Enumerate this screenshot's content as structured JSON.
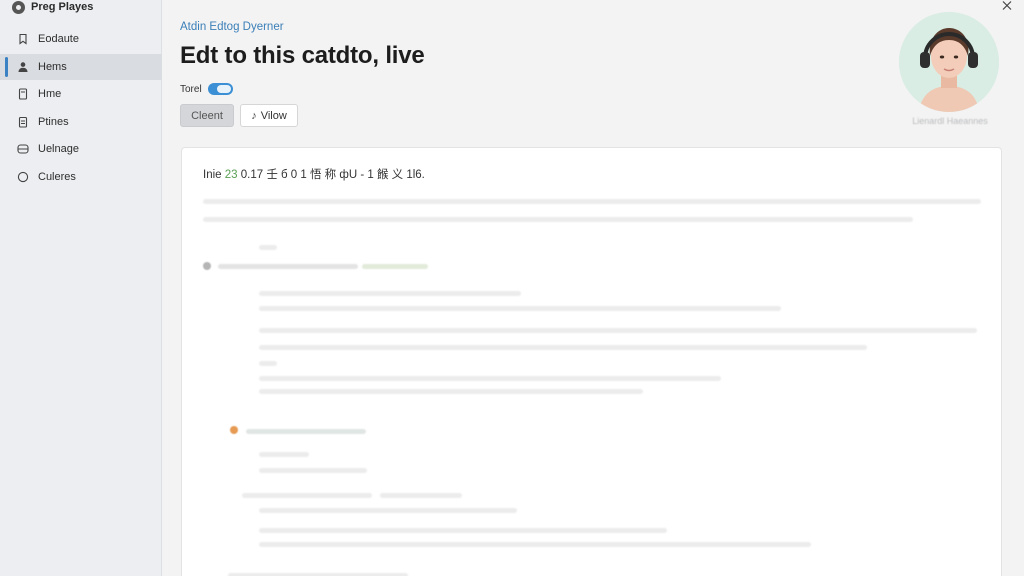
{
  "app": {
    "title": "Preg Playes"
  },
  "sidebar": {
    "items": [
      {
        "label": "Eodaute",
        "icon": "bookmark-icon"
      },
      {
        "label": "Hems",
        "icon": "person-icon"
      },
      {
        "label": "Hme",
        "icon": "document-icon"
      },
      {
        "label": "Ptines",
        "icon": "clipboard-icon"
      },
      {
        "label": "Uelnage",
        "icon": "stack-icon"
      },
      {
        "label": "Culeres",
        "icon": "circle-icon"
      }
    ],
    "active_index": 1
  },
  "header": {
    "subtitle": "Atdin Edtog Dyerner",
    "title": "Edt to this catdto, live",
    "toggle_label": "Torel",
    "toggle_on": true,
    "primary_button": "Cleent",
    "view_button": "Vilow"
  },
  "profile": {
    "caption": "Lienardl Haeannes"
  },
  "card": {
    "line_prefix": "Inie ",
    "line_num": "23",
    "line_rest": " 0.17 壬 б 0 1 悟 称 фU - 1 餱 义 1l6."
  },
  "colors": {
    "accent": "#3b82c4",
    "link": "#3b7fb8",
    "sidebar_bg": "#eceef1",
    "page_bg": "#f3f3f3"
  }
}
